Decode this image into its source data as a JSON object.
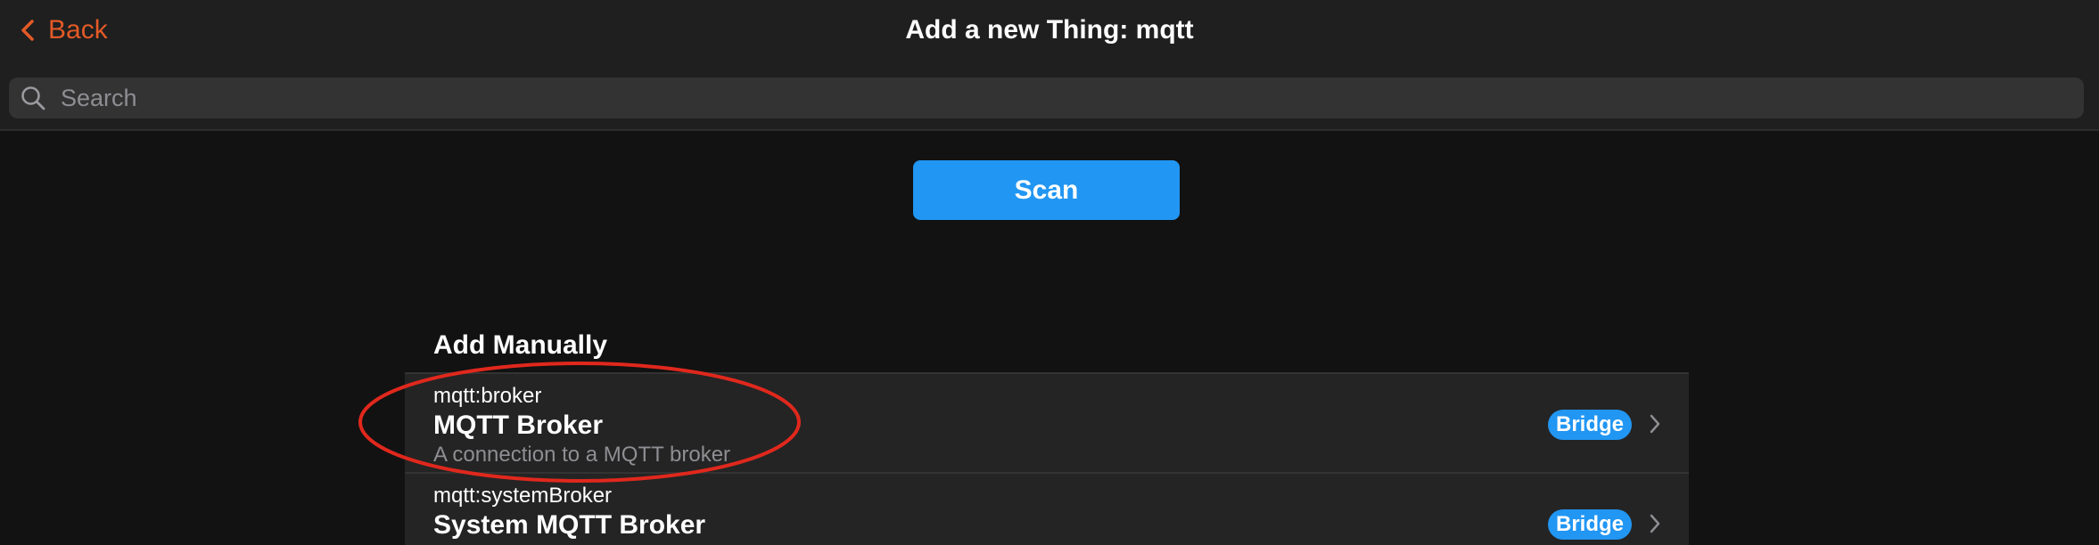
{
  "navbar": {
    "back_label": "Back",
    "title": "Add a new Thing: mqtt"
  },
  "search": {
    "placeholder": "Search",
    "value": ""
  },
  "scan": {
    "label": "Scan"
  },
  "section": {
    "title": "Add Manually",
    "items": [
      {
        "uid": "mqtt:broker",
        "label": "MQTT Broker",
        "description": "A connection to a MQTT broker",
        "badge": "Bridge"
      },
      {
        "uid": "mqtt:systemBroker",
        "label": "System MQTT Broker",
        "description": "",
        "badge": "Bridge"
      }
    ]
  },
  "colors": {
    "accent": "#e35a27",
    "primary": "#2196f3",
    "annotation": "#e0281d"
  },
  "icons": {
    "back": "chevron-left-icon",
    "search": "search-icon",
    "row_chevron": "chevron-right-icon"
  }
}
